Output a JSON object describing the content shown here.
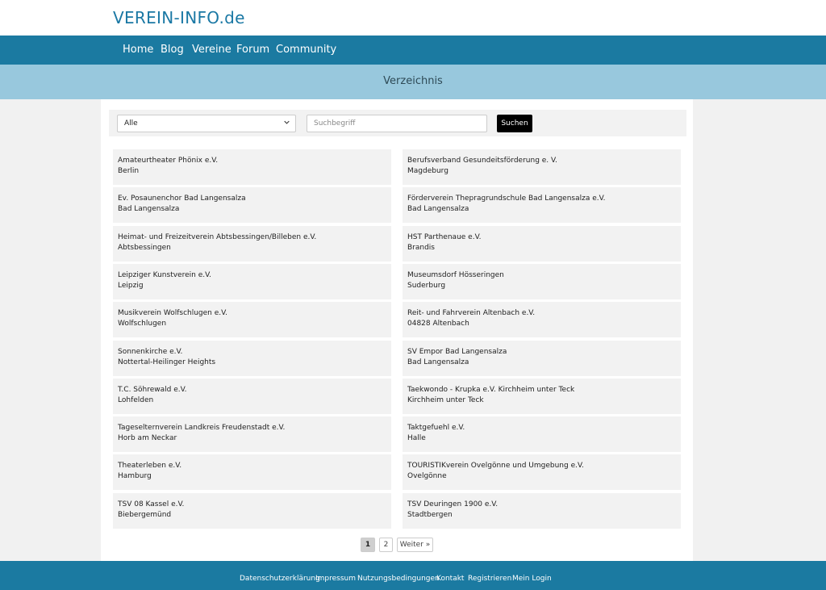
{
  "site": {
    "logo": "VEREIN-INFO.de"
  },
  "nav": {
    "items": [
      "Home",
      "Blog",
      "Vereine",
      "Forum",
      "Community"
    ]
  },
  "banner": {
    "title": "Verzeichnis"
  },
  "search": {
    "select_value": "Alle",
    "input_placeholder": "Suchbegriff",
    "input_value": "",
    "button_label": "Suchen"
  },
  "listings": [
    {
      "name": "Amateurtheater Phönix e.V.",
      "city": "Berlin"
    },
    {
      "name": "Berufsverband Gesundeitsförderung e. V.",
      "city": "Magdeburg"
    },
    {
      "name": "Ev. Posaunenchor Bad Langensalza",
      "city": "Bad Langensalza"
    },
    {
      "name": "Förderverein Thepragrundschule Bad Langensalza e.V.",
      "city": "Bad Langensalza"
    },
    {
      "name": "Heimat- und Freizeitverein Abtsbessingen/Billeben e.V.",
      "city": "Abtsbessingen"
    },
    {
      "name": "HST Parthenaue e.V.",
      "city": "Brandis"
    },
    {
      "name": "Leipziger Kunstverein e.V.",
      "city": "Leipzig"
    },
    {
      "name": "Museumsdorf Hösseringen",
      "city": "Suderburg"
    },
    {
      "name": "Musikverein Wolfschlugen e.V.",
      "city": "Wolfschlugen"
    },
    {
      "name": "Reit- und Fahrverein Altenbach e.V.",
      "city": "04828 Altenbach"
    },
    {
      "name": "Sonnenkirche e.V.",
      "city": "Nottertal-Heilinger Heights"
    },
    {
      "name": "SV Empor Bad Langensalza",
      "city": "Bad Langensalza"
    },
    {
      "name": "T.C. Söhrewald e.V.",
      "city": "Lohfelden"
    },
    {
      "name": "Taekwondo - Krupka e.V. Kirchheim unter Teck",
      "city": "Kirchheim unter Teck"
    },
    {
      "name": "Tageselternverein Landkreis Freudenstadt e.V.",
      "city": "Horb am Neckar"
    },
    {
      "name": "Taktgefuehl e.V.",
      "city": "Halle"
    },
    {
      "name": "Theaterleben e.V.",
      "city": "Hamburg"
    },
    {
      "name": "TOURISTIKverein Ovelgönne und Umgebung e.V.",
      "city": "Ovelgönne"
    },
    {
      "name": "TSV 08 Kassel e.V.",
      "city": "Biebergemünd"
    },
    {
      "name": "TSV Deuringen 1900 e.V.",
      "city": "Stadtbergen"
    }
  ],
  "pagination": {
    "page1": "1",
    "page2": "2",
    "next": "Weiter »",
    "current": 1
  },
  "footer": {
    "links": [
      "Datenschutzerklärung",
      "Impressum",
      "Nutzungsbedingungen",
      "Kontakt",
      "Registrieren",
      "Mein Login"
    ]
  },
  "icons": {
    "select_arrow": "chevron-down-icon"
  },
  "colors": {
    "brand": "#1b7aa1",
    "banner": "#98c8dd",
    "logo": "#1a78a4",
    "button": "#000000"
  }
}
